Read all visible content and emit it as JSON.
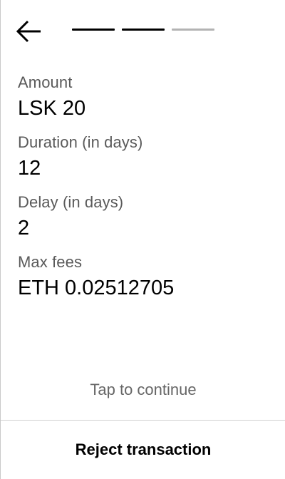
{
  "header": {
    "back_icon": "arrow-left-icon",
    "steps": [
      {
        "state": "complete",
        "color": "#000000"
      },
      {
        "state": "complete",
        "color": "#000000"
      },
      {
        "state": "pending",
        "color": "#b3b3b3"
      }
    ]
  },
  "details": {
    "amount": {
      "label": "Amount",
      "value": "LSK 20"
    },
    "duration": {
      "label": "Duration (in days)",
      "value": "12"
    },
    "delay": {
      "label": "Delay (in days)",
      "value": "2"
    },
    "max_fees": {
      "label": "Max fees",
      "value": "ETH 0.02512705"
    }
  },
  "actions": {
    "tap_continue": "Tap to continue",
    "reject": "Reject transaction"
  },
  "colors": {
    "label": "#5a5a5a",
    "value": "#000000",
    "hint": "#666666",
    "divider": "#cfcfcf"
  }
}
